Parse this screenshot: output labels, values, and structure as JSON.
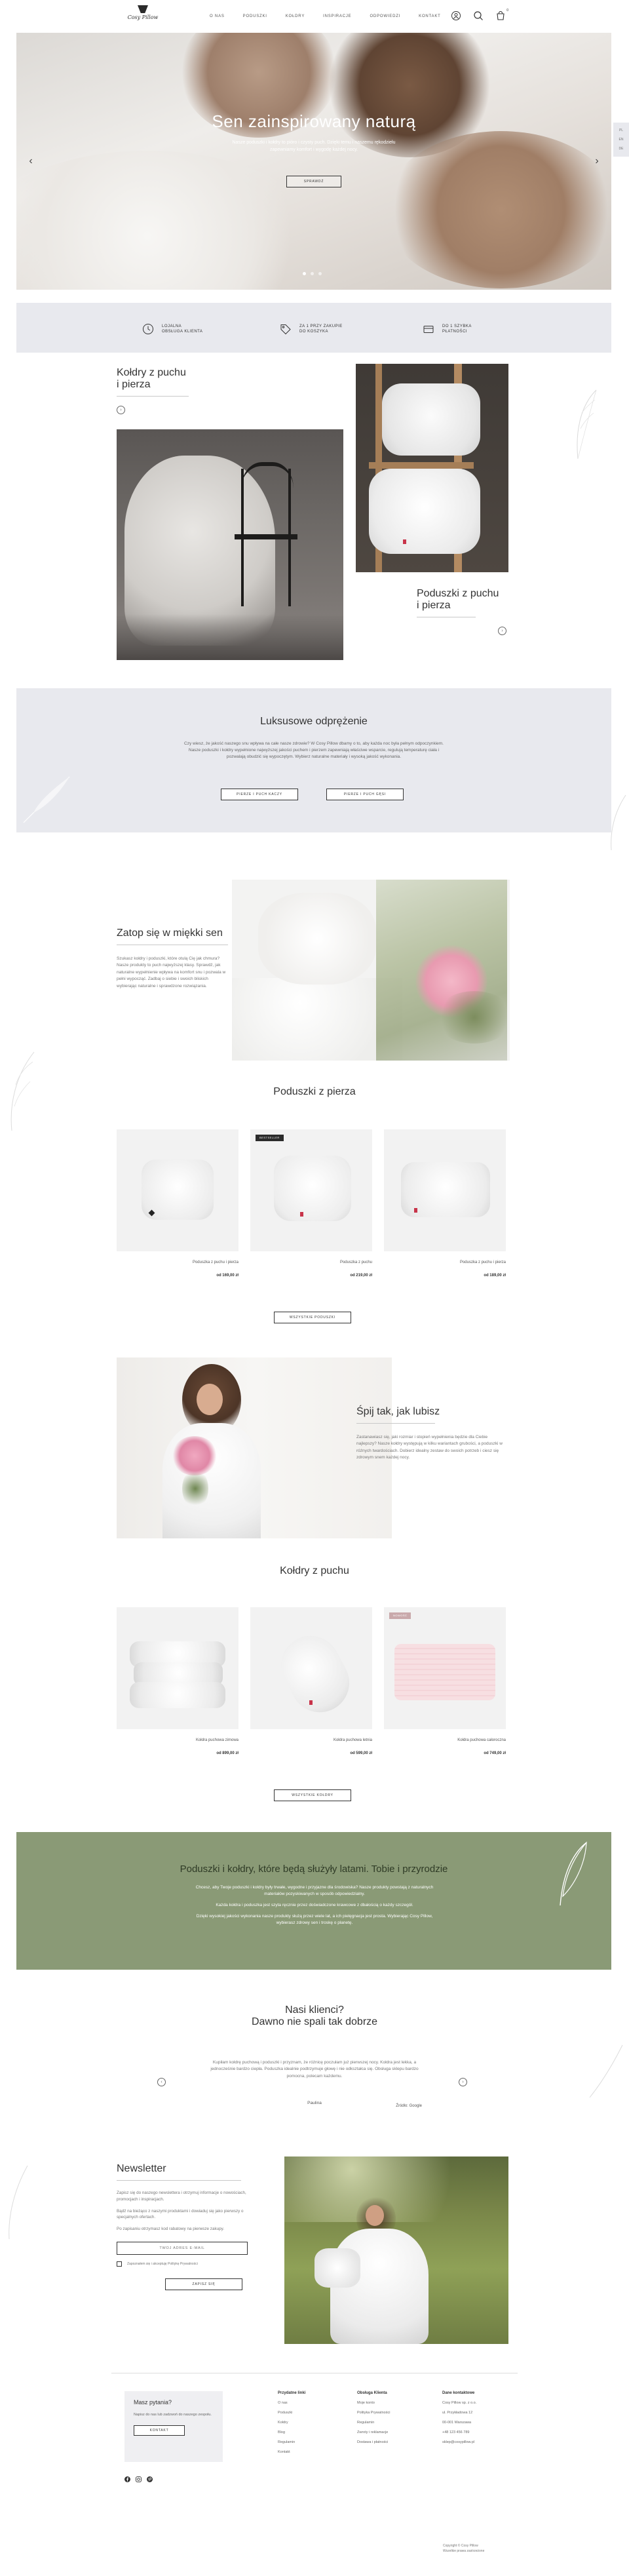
{
  "header": {
    "logo_script": "Cosy Pillow",
    "logo_tag": "",
    "nav": [
      "O NAS",
      "PODUSZKI",
      "KOŁDRY",
      "INSPIRACJE",
      "ODPOWIEDZI",
      "KONTAKT"
    ],
    "cart_count": "0"
  },
  "hero": {
    "title": "Sen zainspirowany naturą",
    "text": "Nasze poduszki i kołdry to pióro i czysty puch. Dzięki temu i naszemu rękodziełu zapewniamy komfort i wygodę każdej nocy.",
    "button": "SPRAWDŹ"
  },
  "sidetab": [
    "PL",
    "EN",
    "DE"
  ],
  "usp": [
    {
      "line1": "LOJALNA",
      "line2": "OBSŁUGA KLIENTA"
    },
    {
      "line1": "ZA 1 PRZY ZAKUPIE",
      "line2": "DO KOSZYKA"
    },
    {
      "line1": "DO 1 SZYBKA",
      "line2": "PŁATNOŚCI"
    }
  ],
  "feature1": {
    "title_line1": "Kołdry z puchu",
    "title_line2": "i pierza"
  },
  "feature2": {
    "title_line1": "Poduszki z puchu",
    "title_line2": "i pierza"
  },
  "luxury": {
    "title": "Luksusowe odprężenie",
    "text": "Czy wiesz, że jakość naszego snu wpływa na całe nasze zdrowie? W Cosy Pillow dbamy o to, aby każda noc była pełnym odpoczynkiem. Nasze poduszki i kołdry wypełnione najwyższej jakości puchem i pierzem zapewniają właściwe wsparcie, regulują temperaturę ciała i pozwalają obudzić się wypoczętym. Wybierz naturalne materiały i wysoką jakość wykonania.",
    "btn1": "PIERZE I PUCH KACZY",
    "btn2": "PIERZE I PUCH GĘSI"
  },
  "soft": {
    "title": "Zatop się w miękki sen",
    "text": "Szukasz kołdry i poduszki, które otulą Cię jak chmura? Nasze produkty to puch najwyższej klasy. Sprawdź, jak naturalne wypełnienie wpływa na komfort snu i pozwala w pełni wypocząć. Zadbaj o siebie i swoich bliskich wybierając naturalne i sprawdzone rozwiązania."
  },
  "pillows": {
    "title": "Poduszki z pierza",
    "button": "WSZYSTKIE PODUSZKI",
    "items": [
      {
        "name": "Poduszka z puchu i pierza",
        "price": "od 169,00 zł",
        "badge": ""
      },
      {
        "name": "Poduszka z puchu",
        "price": "od 219,00 zł",
        "badge": "BESTSELLER"
      },
      {
        "name": "Poduszka z puchu i pierza",
        "price": "od 189,00 zł",
        "badge": ""
      }
    ]
  },
  "sleep": {
    "title": "Śpij tak, jak lubisz",
    "text": "Zastanawiasz się, jaki rozmiar i stopień wypełnienia będzie dla Ciebie najlepszy? Nasze kołdry występują w kilku wariantach grubości, a poduszki w różnych twardościach. Dobierz idealny zestaw do swoich potrzeb i ciesz się zdrowym snem każdej nocy."
  },
  "duvets": {
    "title": "Kołdry z puchu",
    "button": "WSZYSTKIE KOŁDRY",
    "items": [
      {
        "name": "Kołdra puchowa zimowa",
        "price": "od 899,00 zł",
        "badge": ""
      },
      {
        "name": "Kołdra puchowa letnia",
        "price": "od 599,00 zł",
        "badge": ""
      },
      {
        "name": "Kołdra puchowa całoroczna",
        "price": "od 749,00 zł",
        "badge": "NOWOŚĆ"
      }
    ]
  },
  "green": {
    "title": "Poduszki i kołdry, które będą służyły latami. Tobie i przyrodzie",
    "p1": "Chcesz, aby Twoje poduszki i kołdry były trwałe, wygodne i przyjazne dla środowiska? Nasze produkty powstają z naturalnych materiałów pozyskiwanych w sposób odpowiedzialny.",
    "p2": "Każda kołdra i poduszka jest szyta ręcznie przez doświadczone krawcowe z dbałością o każdy szczegół.",
    "p3": "Dzięki wysokiej jakości wykonania nasze produkty służą przez wiele lat, a ich pielęgnacja jest prosta. Wybierając Cosy Pillow, wybierasz zdrowy sen i troskę o planetę."
  },
  "reviews": {
    "title_line1": "Nasi klienci?",
    "title_line2": "Dawno nie spali tak dobrze",
    "text": "Kupiłam kołdrę puchową i poduszki i przyznam, że różnicę poczułam już pierwszej nocy. Kołdra jest lekka, a jednocześnie bardzo ciepła. Poduszka idealnie podtrzymuje głowę i nie odkształca się. Obsługa sklepu bardzo pomocna, polecam każdemu.",
    "author": "Paulina",
    "meta": "Źródło: Google"
  },
  "newsletter": {
    "title": "Newsletter",
    "text1": "Zapisz się do naszego newslettera i otrzymuj informacje o nowościach, promocjach i inspiracjach.",
    "text2": "Bądź na bieżąco z naszymi produktami i dowiaduj się jako pierwszy o specjalnych ofertach.",
    "text3": "Po zapisaniu otrzymasz kod rabatowy na pierwsze zakupy.",
    "input_placeholder": "TWÓJ ADRES E-MAIL",
    "consent": "Zapoznałem się i akceptuję Politykę Prywatności",
    "button": "ZAPISZ SIĘ"
  },
  "footer": {
    "help_title": "Masz pytania?",
    "help_text": "Napisz do nas lub zadzwoń do naszego zespołu.",
    "help_button": "KONTAKT",
    "col1_title": "Przydatne linki",
    "col1": [
      "O nas",
      "Poduszki",
      "Kołdry",
      "Blog",
      "Regulamin",
      "Kontakt"
    ],
    "col2_title": "Obsługa Klienta",
    "col2": [
      "Moje konto",
      "Polityka Prywatności",
      "Regulamin",
      "Zwroty i reklamacje",
      "Dostawa i płatności"
    ],
    "col3_title": "Dane kontaktowe",
    "col3": [
      "Cosy Pillow sp. z o.o.",
      "ul. Przykładowa 12",
      "00-001 Warszawa",
      "+48 123 456 789",
      "sklep@cosypillow.pl"
    ],
    "copy1": "Copyright © Cosy Pillow",
    "copy2": "Wszelkie prawa zastrzeżone"
  }
}
